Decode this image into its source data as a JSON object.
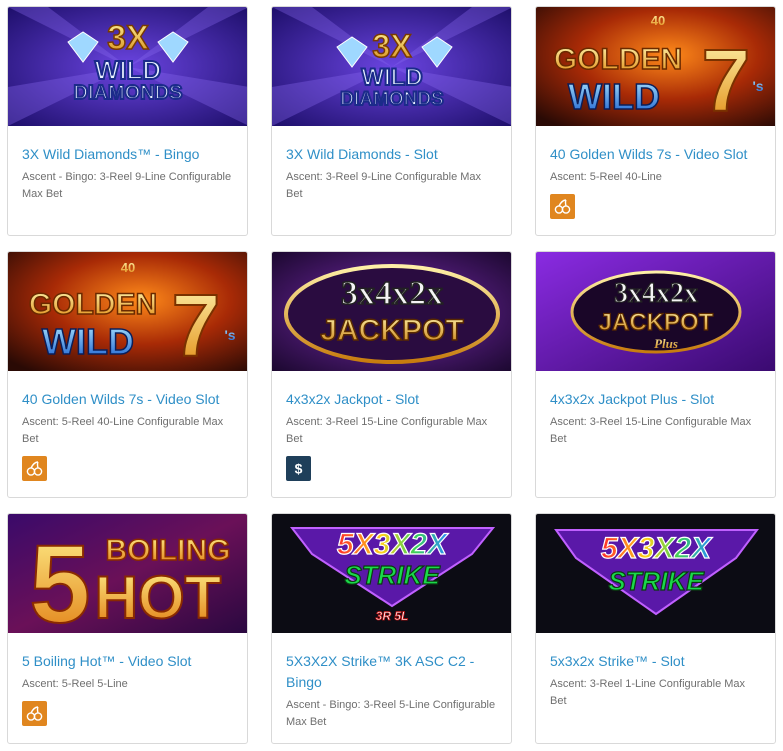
{
  "games": [
    {
      "title": "3X Wild Diamonds™ - Bingo",
      "meta": "Ascent - Bingo: 3-Reel 9-Line Configurable Max Bet",
      "badge": "",
      "art": {
        "line1": "3X",
        "line2": "WILD",
        "line3": "DIAMONDS"
      }
    },
    {
      "title": "3X Wild Diamonds - Slot",
      "meta": "Ascent: 3-Reel 9-Line Configurable Max Bet",
      "badge": "",
      "art": {
        "line1": "3X",
        "line2": "WILD",
        "line3": "DIAMONDS"
      }
    },
    {
      "title": "40 Golden Wilds 7s - Video Slot",
      "meta": "Ascent: 5-Reel 40-Line",
      "badge": "cherry-icon",
      "art": {
        "top": "40",
        "line1": "GOLDEN",
        "line2": "WILD",
        "big": "7",
        "suffix": "'s"
      }
    },
    {
      "title": "40 Golden Wilds 7s - Video Slot",
      "meta": "Ascent: 5-Reel 40-Line Configurable Max Bet",
      "badge": "cherry-icon",
      "art": {
        "top": "40",
        "line1": "GOLDEN",
        "line2": "WILD",
        "big": "7",
        "suffix": "'s"
      }
    },
    {
      "title": "4x3x2x Jackpot - Slot",
      "meta": "Ascent: 3-Reel 15-Line Configurable Max Bet",
      "badge": "dollar-icon",
      "art": {
        "line1": "3x4x2x",
        "line2": "JACKPOT"
      }
    },
    {
      "title": "4x3x2x Jackpot Plus - Slot",
      "meta": "Ascent: 3-Reel 15-Line Configurable Max Bet",
      "badge": "",
      "art": {
        "line1": "3x4x2x",
        "line2": "JACKPOT",
        "line3": "Plus"
      }
    },
    {
      "title": "5 Boiling Hot™ - Video Slot",
      "meta": "Ascent: 5-Reel 5-Line",
      "badge": "cherry-icon",
      "art": {
        "big": "5",
        "line1": "BOILING",
        "line2": "HOT"
      }
    },
    {
      "title": "5X3X2X Strike™ 3K ASC C2 - Bingo",
      "meta": "Ascent - Bingo: 3-Reel 5-Line Configurable Max Bet",
      "badge": "",
      "art": {
        "line1": "5X3X2X",
        "line2": "STRIKE",
        "line3": "3R 5L"
      }
    },
    {
      "title": "5x3x2x Strike™ - Slot",
      "meta": "Ascent: 3-Reel 1-Line Configurable Max Bet",
      "badge": "",
      "art": {
        "line1": "5X3X2X",
        "line2": "STRIKE"
      }
    }
  ],
  "colors": {
    "link": "#2f8fc7",
    "meta": "#6f6f6f",
    "cherry_badge": "#e0861f",
    "dollar_badge": "#1f3f5a"
  }
}
